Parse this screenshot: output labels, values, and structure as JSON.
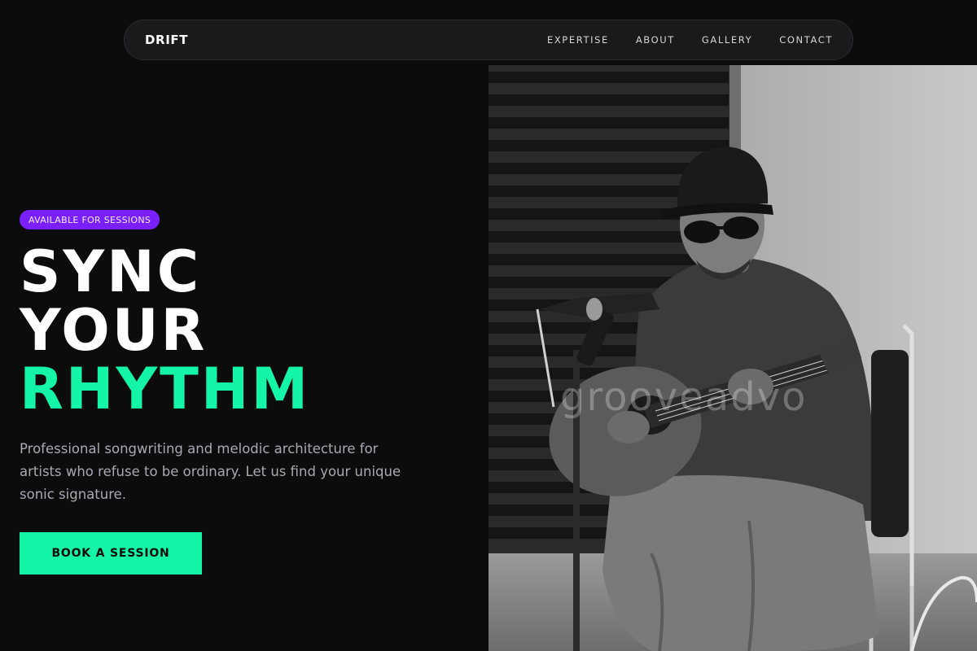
{
  "nav": {
    "brand": "DRIFT",
    "links": [
      "EXPERTISE",
      "ABOUT",
      "GALLERY",
      "CONTACT"
    ]
  },
  "hero": {
    "badge": "AVAILABLE FOR SESSIONS",
    "headline_lines": [
      "SYNC",
      "YOUR",
      "RHYTHM"
    ],
    "description": "Professional songwriting and melodic architecture for artists who refuse to be ordinary. Let us find your unique sonic signature.",
    "cta_label": "BOOK A SESSION"
  },
  "photo": {
    "subject": "musician-with-acoustic-guitar-photo",
    "watermark": "grooveadvo"
  },
  "colors": {
    "background": "#0c0c0d",
    "accent_green": "#14f5a8",
    "badge_purple": "#7a1fff",
    "nav_bg": "#1a1a1c",
    "text_muted": "#a9a9b3"
  }
}
